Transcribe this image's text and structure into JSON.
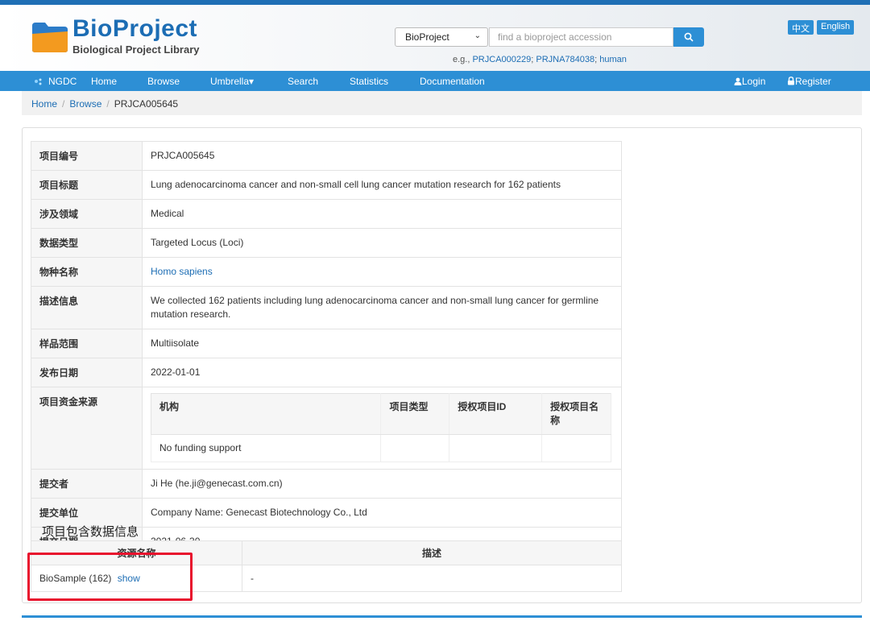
{
  "header": {
    "title": "BioProject",
    "subtitle": "Biological Project Library",
    "search": {
      "selected": "BioProject",
      "placeholder": "find a bioproject accession",
      "examples_prefix": "e.g., ",
      "examples": [
        "PRJCA000229",
        "PRJNA784038",
        "human"
      ]
    },
    "lang": {
      "zh": "中文",
      "en": "English"
    }
  },
  "nav": {
    "brand": "NGDC",
    "items": [
      "Home",
      "Browse",
      "Umbrella",
      "Search",
      "Statistics",
      "Documentation"
    ],
    "umbrella_caret": "▾",
    "login": "Login",
    "register": "Register"
  },
  "breadcrumb": {
    "home": "Home",
    "browse": "Browse",
    "current": "PRJCA005645",
    "sep": "/"
  },
  "info": {
    "accession": {
      "label": "项目编号",
      "value": "PRJCA005645"
    },
    "title": {
      "label": "项目标题",
      "value": "Lung adenocarcinoma cancer and non-small cell lung cancer mutation research for 162 patients"
    },
    "field": {
      "label": "涉及领域",
      "value": "Medical"
    },
    "data_type": {
      "label": "数据类型",
      "value": "Targeted Locus (Loci)"
    },
    "organism": {
      "label": "物种名称",
      "value": "Homo sapiens"
    },
    "description": {
      "label": "描述信息",
      "value": "We collected 162 patients including lung adenocarcinoma cancer and non-small lung cancer for germline mutation research."
    },
    "sample_scope": {
      "label": "样品范围",
      "value": "Multiisolate"
    },
    "release_date": {
      "label": "发布日期",
      "value": "2022-01-01"
    },
    "funding": {
      "label": "项目资金来源",
      "columns": [
        "机构",
        "项目类型",
        "授权项目ID",
        "授权项目名称"
      ],
      "row": "No funding support"
    },
    "submitter": {
      "label": "提交者",
      "value": "Ji He (he.ji@genecast.com.cn)"
    },
    "organization": {
      "label": "提交单位",
      "value": "Company Name: Genecast Biotechnology Co., Ltd"
    },
    "submission_date": {
      "label": "提交日期",
      "value": "2021-06-30"
    }
  },
  "data_section": {
    "title": "项目包含数据信息",
    "columns": [
      "资源名称",
      "描述"
    ],
    "rows": [
      {
        "resource": "BioSample (162)",
        "link": "show",
        "description": "-"
      }
    ]
  },
  "colors": {
    "accent": "#2d8fd5",
    "brand": "#1c6db4",
    "highlight": "#e8112d"
  }
}
